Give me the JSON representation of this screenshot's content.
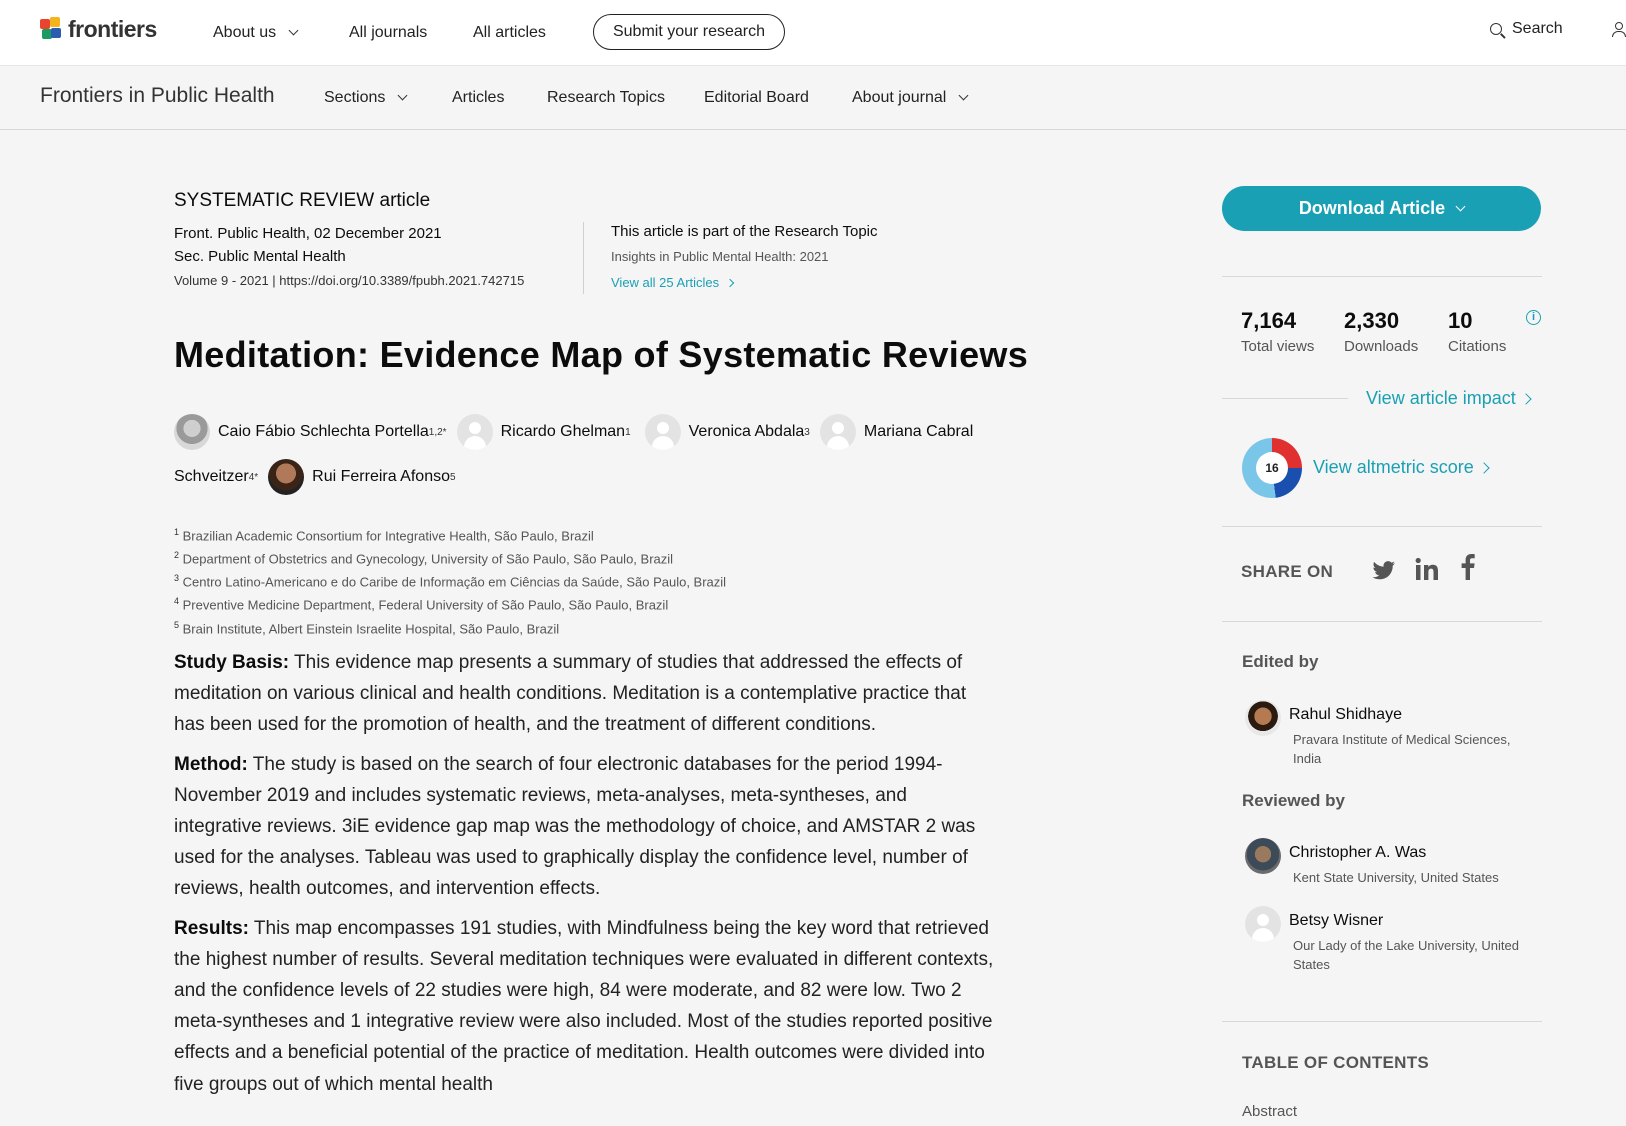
{
  "topbar": {
    "brand": "frontiers",
    "nav": [
      "About us",
      "All journals",
      "All articles"
    ],
    "submit": "Submit your research",
    "search": "Search"
  },
  "journal_bar": {
    "name": "Frontiers in Public Health",
    "nav": [
      "Sections",
      "Articles",
      "Research Topics",
      "Editorial Board",
      "About journal"
    ]
  },
  "article": {
    "type": "SYSTEMATIC REVIEW article",
    "citation": "Front. Public Health, 02 December 2021",
    "section": "Sec. Public Mental Health",
    "volume_doi": "Volume 9 - 2021 | https://doi.org/10.3389/fpubh.2021.742715",
    "research_topic_label": "This article is part of the Research Topic",
    "research_topic_name": "Insights in Public Mental Health: 2021",
    "view_all": "View all 25 Articles",
    "title": "Meditation: Evidence Map of Systematic Reviews",
    "authors": [
      {
        "name": "Caio Fábio Schlechta Portella",
        "sup": "1,2*"
      },
      {
        "name": "Ricardo Ghelman",
        "sup": "1"
      },
      {
        "name": "Veronica Abdala",
        "sup": "3"
      },
      {
        "name": "Mariana Cabral",
        "sup": ""
      },
      {
        "name": "Schveitzer",
        "sup": "4*"
      },
      {
        "name": "Rui Ferreira Afonso",
        "sup": "5"
      }
    ],
    "affiliations": [
      {
        "n": "1",
        "text": "Brazilian Academic Consortium for Integrative Health, São Paulo, Brazil"
      },
      {
        "n": "2",
        "text": "Department of Obstetrics and Gynecology, University of São Paulo, São Paulo, Brazil"
      },
      {
        "n": "3",
        "text": "Centro Latino-Americano e do Caribe de Informação em Ciências da Saúde, São Paulo, Brazil"
      },
      {
        "n": "4",
        "text": "Preventive Medicine Department, Federal University of São Paulo, São Paulo, Brazil"
      },
      {
        "n": "5",
        "text": "Brain Institute, Albert Einstein Israelite Hospital, São Paulo, Brazil"
      }
    ],
    "abstract": [
      {
        "label": "Study Basis:",
        "text": " This evidence map presents a summary of studies that addressed the effects of meditation on various clinical and health conditions. Meditation is a contemplative practice that has been used for the promotion of health, and the treatment of different conditions."
      },
      {
        "label": "Method:",
        "text": " The study is based on the search of four electronic databases for the period 1994-November 2019 and includes systematic reviews, meta-analyses, meta-syntheses, and integrative reviews. 3iE evidence gap map was the methodology of choice, and AMSTAR 2 was used for the analyses. Tableau was used to graphically display the confidence level, number of reviews, health outcomes, and intervention effects."
      },
      {
        "label": "Results:",
        "text": " This map encompasses 191 studies, with Mindfulness being the key word that retrieved the highest number of results. Several meditation techniques were evaluated in different contexts, and the confidence levels of 22 studies were high, 84 were moderate, and 82 were low. Two 2 meta-syntheses and 1 integrative review were also included. Most of the studies reported positive effects and a beneficial potential of the practice of meditation. Health outcomes were divided into five groups out of which mental health"
      }
    ]
  },
  "sidebar": {
    "download": "Download Article",
    "metrics": [
      {
        "num": "7,164",
        "label": "Total views"
      },
      {
        "num": "2,330",
        "label": "Downloads"
      },
      {
        "num": "10",
        "label": "Citations"
      }
    ],
    "impact_link": "View article impact",
    "altmetric_score": "16",
    "altmetric_link": "View altmetric score",
    "share_label": "SHARE ON",
    "edited_by": "Edited by",
    "editor": {
      "name": "Rahul Shidhaye",
      "aff": "Pravara Institute of Medical Sciences, India"
    },
    "reviewed_by": "Reviewed by",
    "reviewers": [
      {
        "name": "Christopher A. Was",
        "aff": "Kent State University, United States"
      },
      {
        "name": "Betsy Wisner",
        "aff": "Our Lady of the Lake University, United States"
      }
    ],
    "toc_title": "TABLE OF CONTENTS",
    "toc_first": "Abstract"
  },
  "colors": {
    "accent": "#1aa0b4",
    "background": "#f5f5f5"
  }
}
